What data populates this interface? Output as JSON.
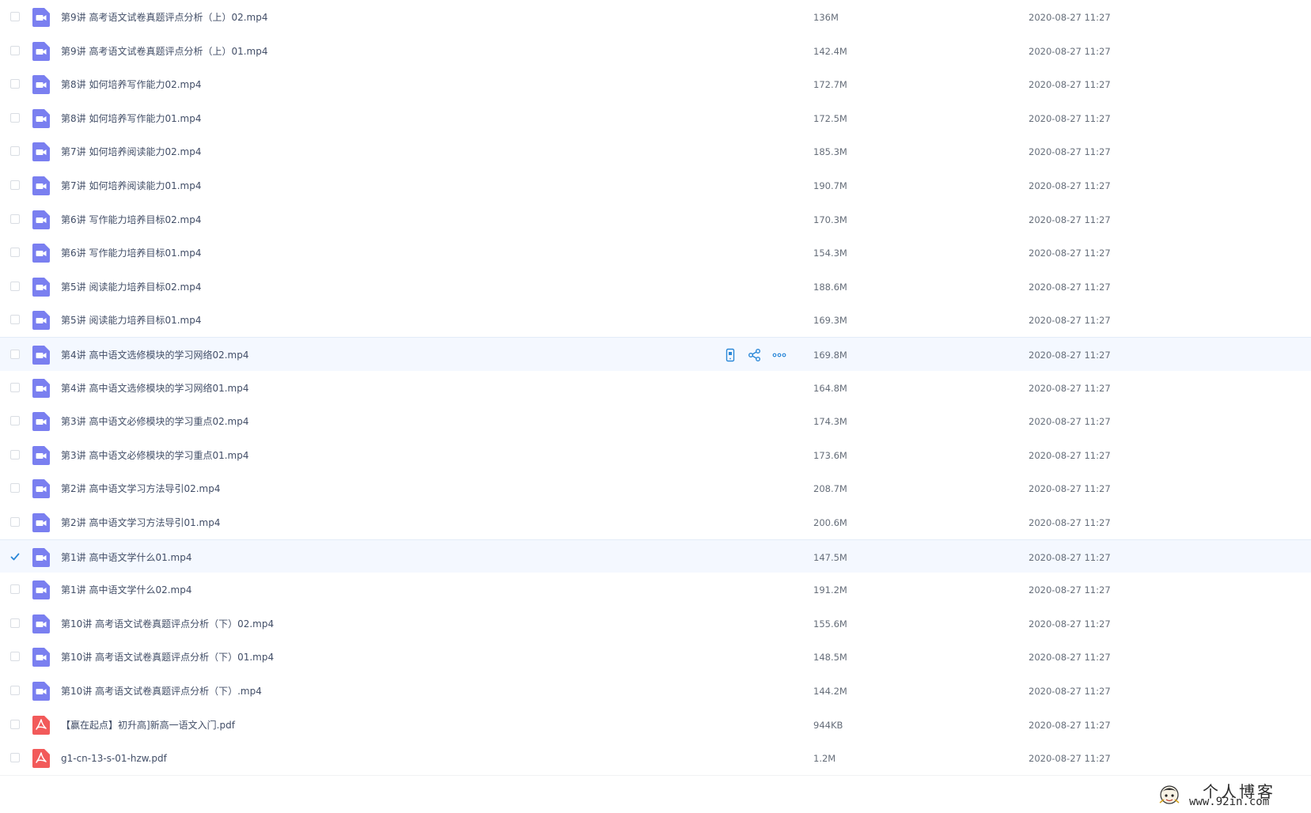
{
  "files": [
    {
      "name": "第9讲 高考语文试卷真题评点分析（上）02.mp4",
      "size": "136M",
      "date": "2020-08-27 11:27",
      "type": "video",
      "checked": false,
      "state": "normal"
    },
    {
      "name": "第9讲 高考语文试卷真题评点分析（上）01.mp4",
      "size": "142.4M",
      "date": "2020-08-27 11:27",
      "type": "video",
      "checked": false,
      "state": "normal"
    },
    {
      "name": "第8讲 如何培养写作能力02.mp4",
      "size": "172.7M",
      "date": "2020-08-27 11:27",
      "type": "video",
      "checked": false,
      "state": "normal"
    },
    {
      "name": "第8讲 如何培养写作能力01.mp4",
      "size": "172.5M",
      "date": "2020-08-27 11:27",
      "type": "video",
      "checked": false,
      "state": "normal"
    },
    {
      "name": "第7讲 如何培养阅读能力02.mp4",
      "size": "185.3M",
      "date": "2020-08-27 11:27",
      "type": "video",
      "checked": false,
      "state": "normal"
    },
    {
      "name": "第7讲 如何培养阅读能力01.mp4",
      "size": "190.7M",
      "date": "2020-08-27 11:27",
      "type": "video",
      "checked": false,
      "state": "normal"
    },
    {
      "name": "第6讲 写作能力培养目标02.mp4",
      "size": "170.3M",
      "date": "2020-08-27 11:27",
      "type": "video",
      "checked": false,
      "state": "normal"
    },
    {
      "name": "第6讲 写作能力培养目标01.mp4",
      "size": "154.3M",
      "date": "2020-08-27 11:27",
      "type": "video",
      "checked": false,
      "state": "normal"
    },
    {
      "name": "第5讲 阅读能力培养目标02.mp4",
      "size": "188.6M",
      "date": "2020-08-27 11:27",
      "type": "video",
      "checked": false,
      "state": "normal"
    },
    {
      "name": "第5讲 阅读能力培养目标01.mp4",
      "size": "169.3M",
      "date": "2020-08-27 11:27",
      "type": "video",
      "checked": false,
      "state": "normal"
    },
    {
      "name": "第4讲 高中语文选修模块的学习网络02.mp4",
      "size": "169.8M",
      "date": "2020-08-27 11:27",
      "type": "video",
      "checked": false,
      "state": "hovered"
    },
    {
      "name": "第4讲 高中语文选修模块的学习网络01.mp4",
      "size": "164.8M",
      "date": "2020-08-27 11:27",
      "type": "video",
      "checked": false,
      "state": "normal"
    },
    {
      "name": "第3讲 高中语文必修模块的学习重点02.mp4",
      "size": "174.3M",
      "date": "2020-08-27 11:27",
      "type": "video",
      "checked": false,
      "state": "normal"
    },
    {
      "name": "第3讲 高中语文必修模块的学习重点01.mp4",
      "size": "173.6M",
      "date": "2020-08-27 11:27",
      "type": "video",
      "checked": false,
      "state": "normal"
    },
    {
      "name": "第2讲 高中语文学习方法导引02.mp4",
      "size": "208.7M",
      "date": "2020-08-27 11:27",
      "type": "video",
      "checked": false,
      "state": "normal"
    },
    {
      "name": "第2讲 高中语文学习方法导引01.mp4",
      "size": "200.6M",
      "date": "2020-08-27 11:27",
      "type": "video",
      "checked": false,
      "state": "normal"
    },
    {
      "name": "第1讲 高中语文学什么01.mp4",
      "size": "147.5M",
      "date": "2020-08-27 11:27",
      "type": "video",
      "checked": true,
      "state": "selected"
    },
    {
      "name": "第1讲 高中语文学什么02.mp4",
      "size": "191.2M",
      "date": "2020-08-27 11:27",
      "type": "video",
      "checked": false,
      "state": "normal"
    },
    {
      "name": "第10讲 高考语文试卷真题评点分析（下）02.mp4",
      "size": "155.6M",
      "date": "2020-08-27 11:27",
      "type": "video",
      "checked": false,
      "state": "normal"
    },
    {
      "name": "第10讲 高考语文试卷真题评点分析（下）01.mp4",
      "size": "148.5M",
      "date": "2020-08-27 11:27",
      "type": "video",
      "checked": false,
      "state": "normal"
    },
    {
      "name": "第10讲 高考语文试卷真题评点分析（下）.mp4",
      "size": "144.2M",
      "date": "2020-08-27 11:27",
      "type": "video",
      "checked": false,
      "state": "normal"
    },
    {
      "name": "【赢在起点】初升高]新高一语文入门.pdf",
      "size": "944KB",
      "date": "2020-08-27 11:27",
      "type": "pdf",
      "checked": false,
      "state": "normal"
    },
    {
      "name": "g1-cn-13-s-01-hzw.pdf",
      "size": "1.2M",
      "date": "2020-08-27 11:27",
      "type": "pdf",
      "checked": false,
      "state": "normal"
    }
  ],
  "row_actions": [
    "mobile-icon",
    "share-icon",
    "more-icon"
  ],
  "watermark": {
    "title": "个人博客",
    "url": "www.92in.com"
  },
  "colors": {
    "video_icon": "#7a7ff0",
    "pdf_icon": "#f25a5a",
    "accent": "#2b88d8",
    "hover_bg": "#f4f8ff"
  }
}
